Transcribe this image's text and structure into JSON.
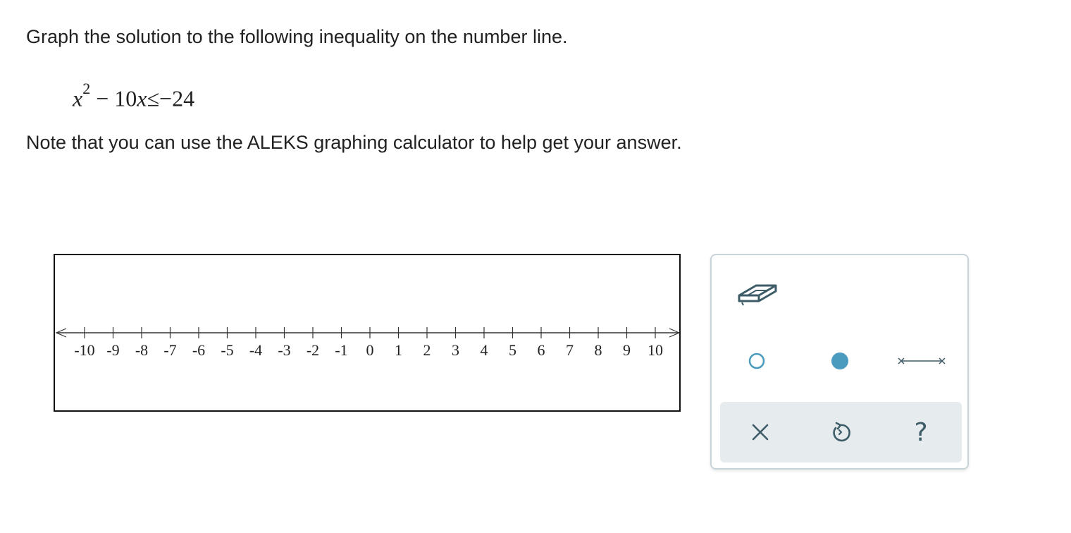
{
  "question": {
    "prompt": "Graph the solution to the following inequality on the number line.",
    "equation": {
      "variable": "x",
      "exponent": "2",
      "rest": " − 10",
      "variable2": "x",
      "relation": "≤−24"
    },
    "note": "Note that you can use the ALEKS graphing calculator to help get your answer."
  },
  "number_line": {
    "min": -10,
    "max": 10,
    "tick_labels": [
      "-10",
      "-9",
      "-8",
      "-7",
      "-6",
      "-5",
      "-4",
      "-3",
      "-2",
      "-1",
      "0",
      "1",
      "2",
      "3",
      "4",
      "5",
      "6",
      "7",
      "8",
      "9",
      "10"
    ]
  },
  "tools": {
    "eraser_icon": "eraser-icon",
    "open_point_icon": "open-circle-icon",
    "closed_point_icon": "filled-circle-icon",
    "segment_icon": "segment-icon",
    "accent_color": "#4a9bbd"
  },
  "actions": {
    "clear_icon": "x-icon",
    "undo_icon": "undo-icon",
    "help_icon": "question-mark-icon",
    "help_glyph": "?"
  }
}
